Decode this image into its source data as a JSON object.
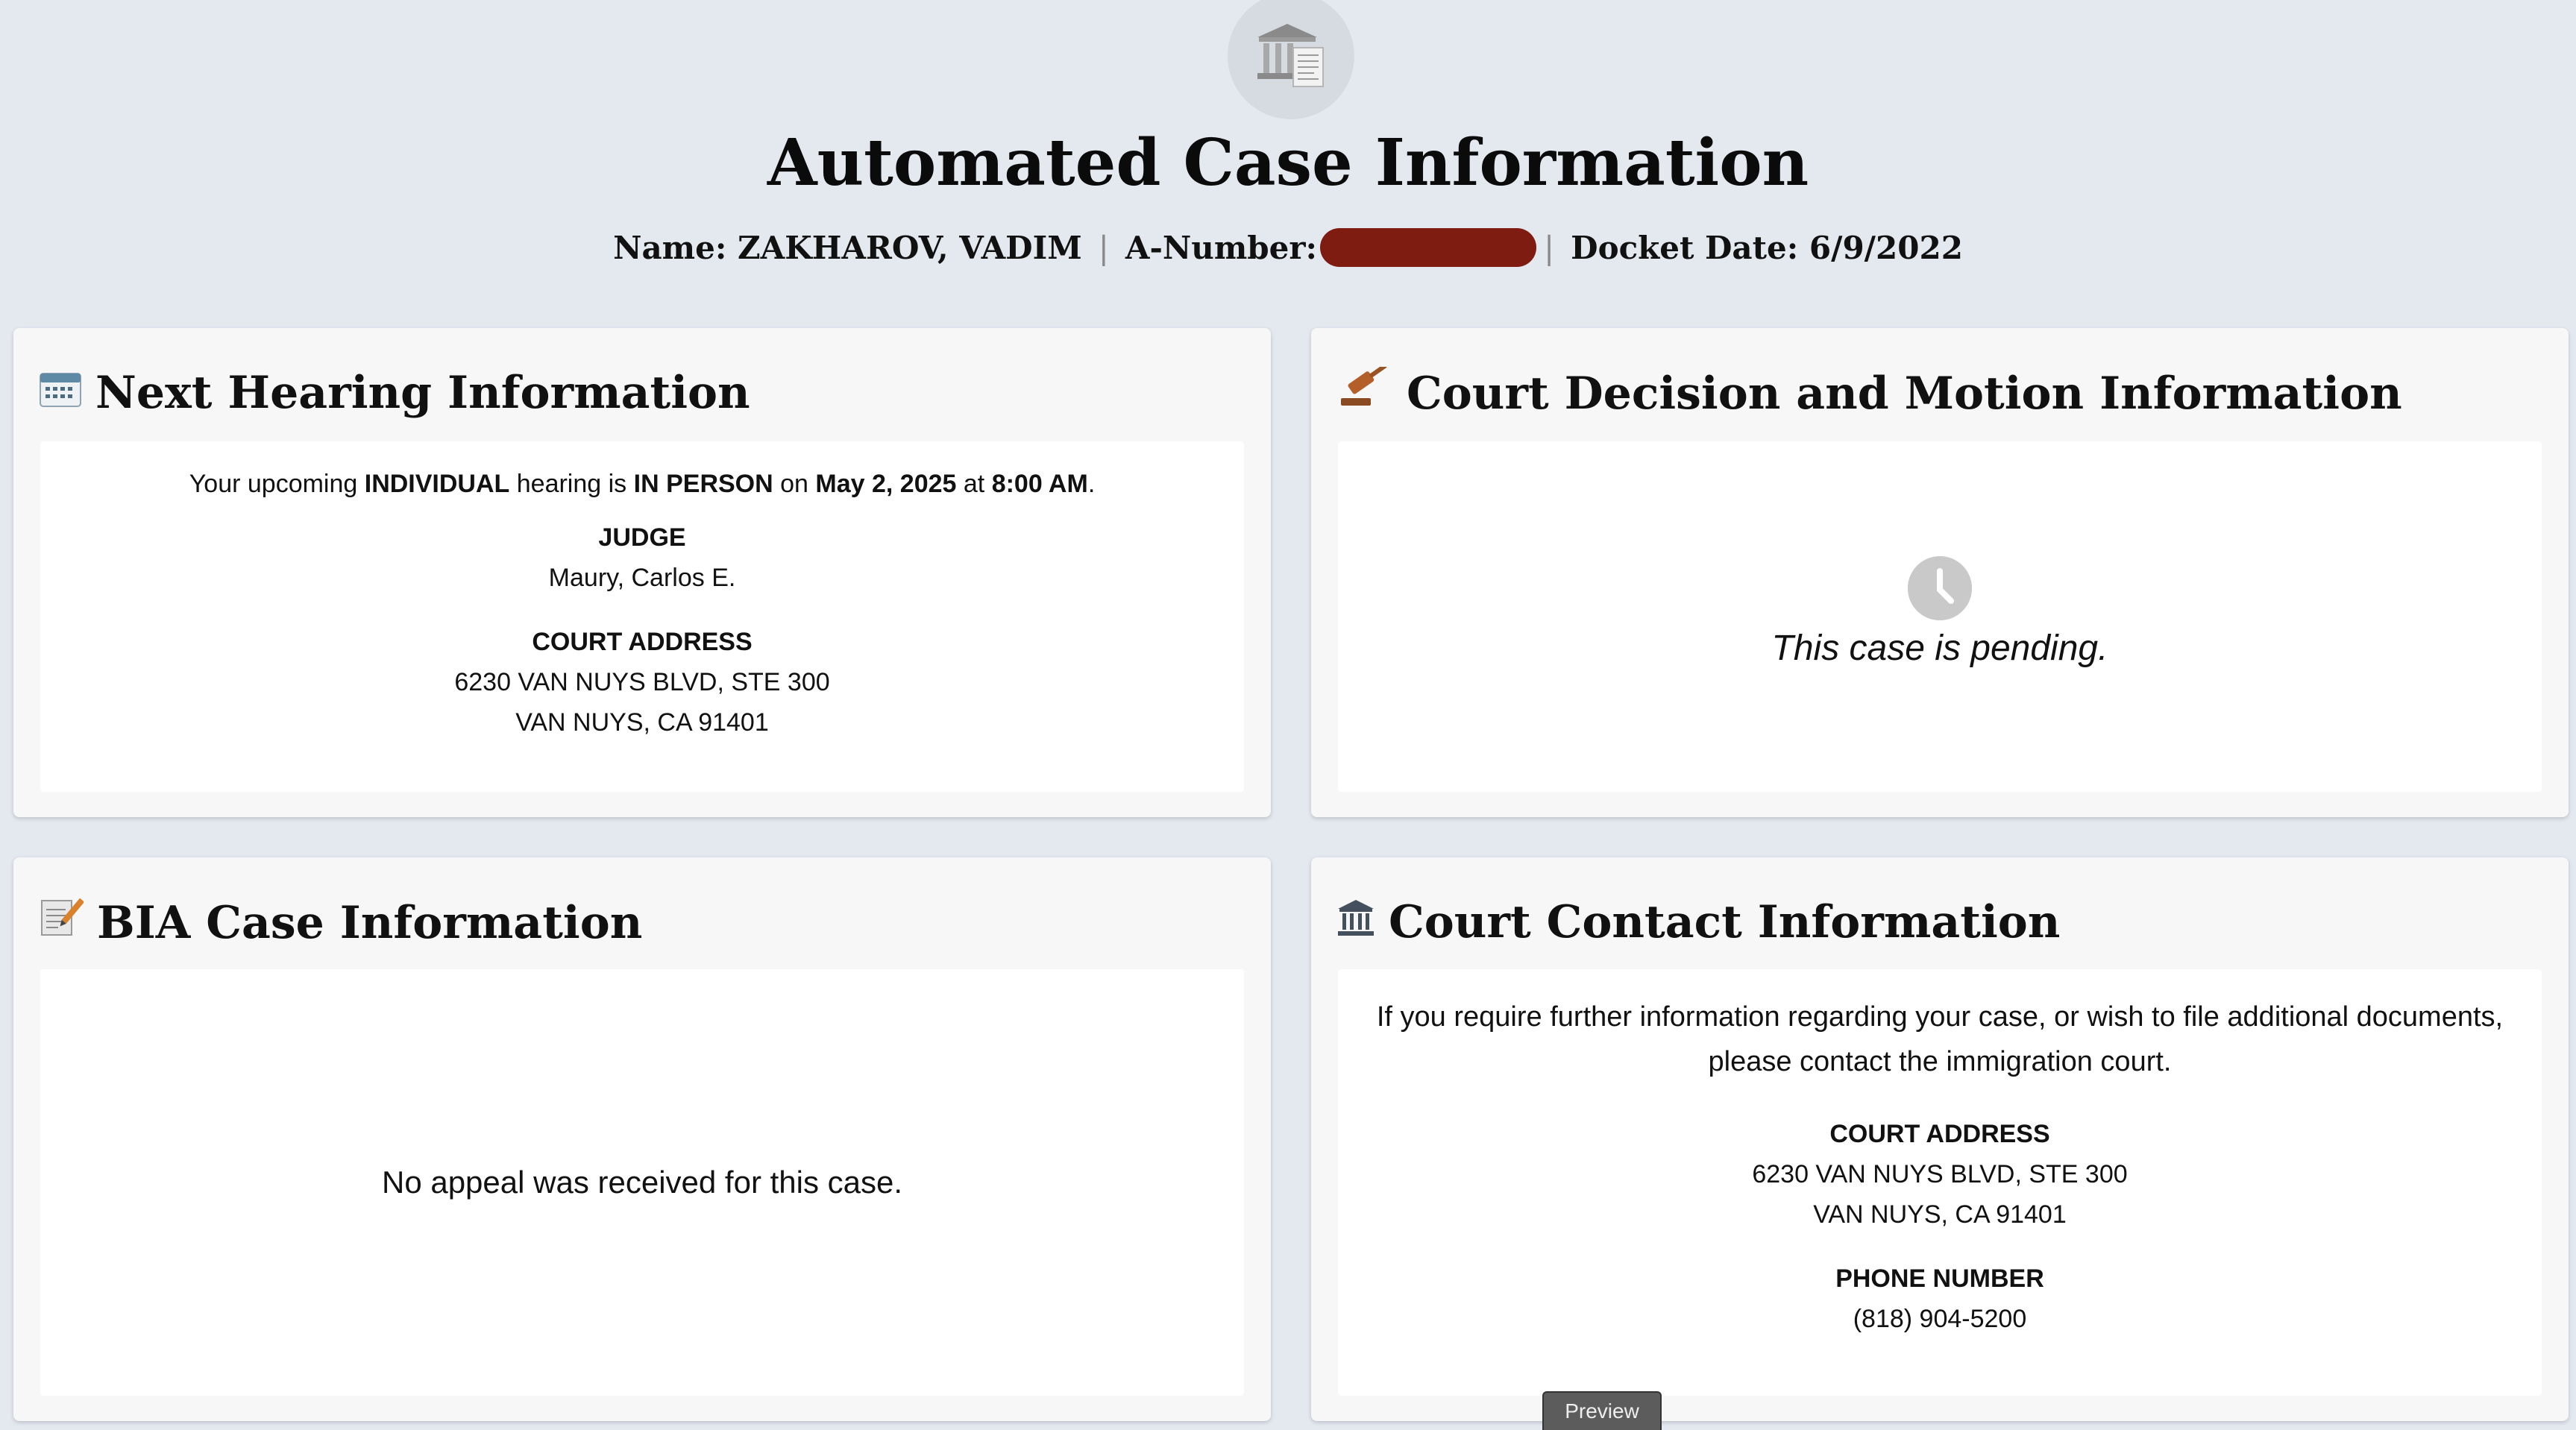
{
  "header": {
    "title": "Automated Case Information",
    "name_label": "Name:",
    "name_value": "ZAKHAROV, VADIM",
    "a_number_label": "A-Number:",
    "docket_label": "Docket Date:",
    "docket_value": "6/9/2022",
    "logo_icon": "courthouse-document-icon"
  },
  "hearing": {
    "title": "Next Hearing Information",
    "icon": "calendar-icon",
    "line_prefix": "Your upcoming ",
    "hearing_type": "INDIVIDUAL",
    "line_mid": " hearing is ",
    "mode": "IN PERSON",
    "on_word": " on ",
    "date": "May 2, 2025",
    "at_word": " at ",
    "time": "8:00 AM",
    "period": ".",
    "judge_label": "JUDGE",
    "judge_name": "Maury, Carlos E.",
    "address_label": "COURT ADDRESS",
    "address_line1": "6230 VAN NUYS BLVD, STE 300",
    "address_line2": "VAN NUYS, CA 91401"
  },
  "decision": {
    "title": "Court Decision and Motion Information",
    "icon": "gavel-icon",
    "status_icon": "clock-icon",
    "status_text": "This case is pending."
  },
  "bia": {
    "title": "BIA Case Information",
    "icon": "memo-icon",
    "message": "No appeal was received for this case."
  },
  "contact": {
    "title": "Court Contact Information",
    "icon": "courthouse-icon",
    "intro_line1": "If you require further information regarding your case, or wish to file additional documents,",
    "intro_line2": "please contact the immigration court.",
    "address_label": "COURT ADDRESS",
    "address_line1": "6230 VAN NUYS BLVD, STE 300",
    "address_line2": "VAN NUYS, CA 91401",
    "phone_label": "PHONE NUMBER",
    "phone_value": "(818) 904-5200"
  },
  "preview_tab": {
    "label": "Preview"
  },
  "colors": {
    "page_bg": "#e4e9f0",
    "card_bg": "#f7f7f7",
    "redaction": "#7f1c12",
    "pending_icon": "#c9c9c9"
  }
}
